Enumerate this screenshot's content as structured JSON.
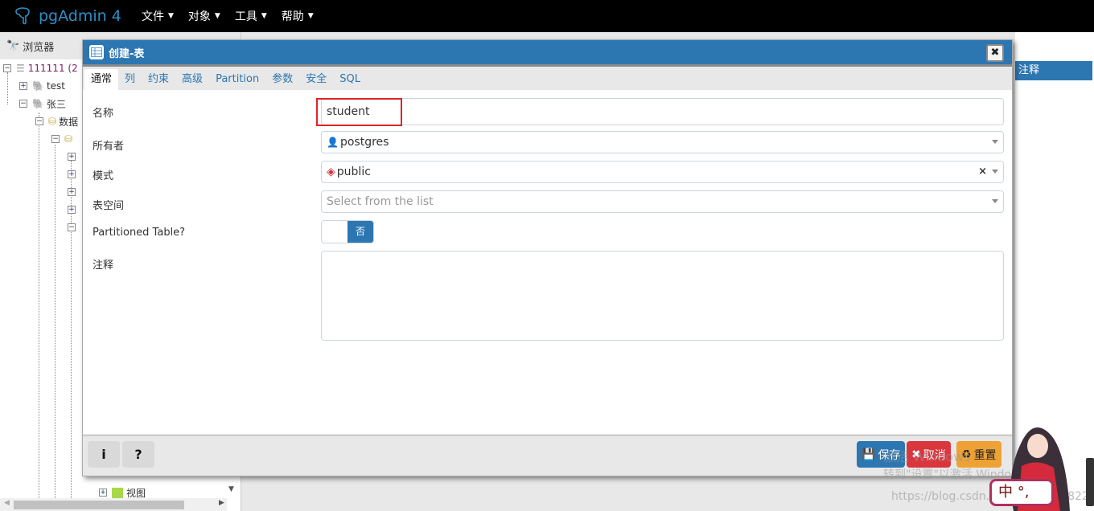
{
  "app": {
    "title": "pgAdmin 4",
    "menus": [
      "文件",
      "对象",
      "工具",
      "帮助"
    ]
  },
  "browser": {
    "title": "浏览器",
    "tree": [
      {
        "label": "111111 (2"
      },
      {
        "label": "test"
      },
      {
        "label": "张三"
      },
      {
        "label": "数据"
      },
      {
        "label": "视图"
      }
    ]
  },
  "right_panel": {
    "header": "注释"
  },
  "dialog": {
    "title": "创建-表",
    "tabs": [
      "通常",
      "列",
      "约束",
      "高级",
      "Partition",
      "参数",
      "安全",
      "SQL"
    ],
    "active_tab": "通常",
    "fields": {
      "name": {
        "label": "名称",
        "value": "student"
      },
      "owner": {
        "label": "所有者",
        "value": "postgres"
      },
      "schema": {
        "label": "模式",
        "value": "public",
        "clear": "×"
      },
      "tablespace": {
        "label": "表空间",
        "placeholder": "Select from the list"
      },
      "partitioned": {
        "label": "Partitioned Table?",
        "value": "否"
      },
      "comment": {
        "label": "注释",
        "value": ""
      }
    },
    "footer": {
      "info": "i",
      "help": "?",
      "save": "保存",
      "cancel": "取消",
      "reset": "重置"
    },
    "colors": {
      "save": "#2c76b2",
      "cancel": "#d9363e",
      "reset": "#eea236",
      "header": "#2c76b2"
    }
  },
  "watermark": {
    "line1": "激活 Windows",
    "line2": "转到\"设置\"以激活 Windows。",
    "url": "https://blog.csdn.net/qq_40127822"
  },
  "ime": {
    "label": "中 °,"
  }
}
